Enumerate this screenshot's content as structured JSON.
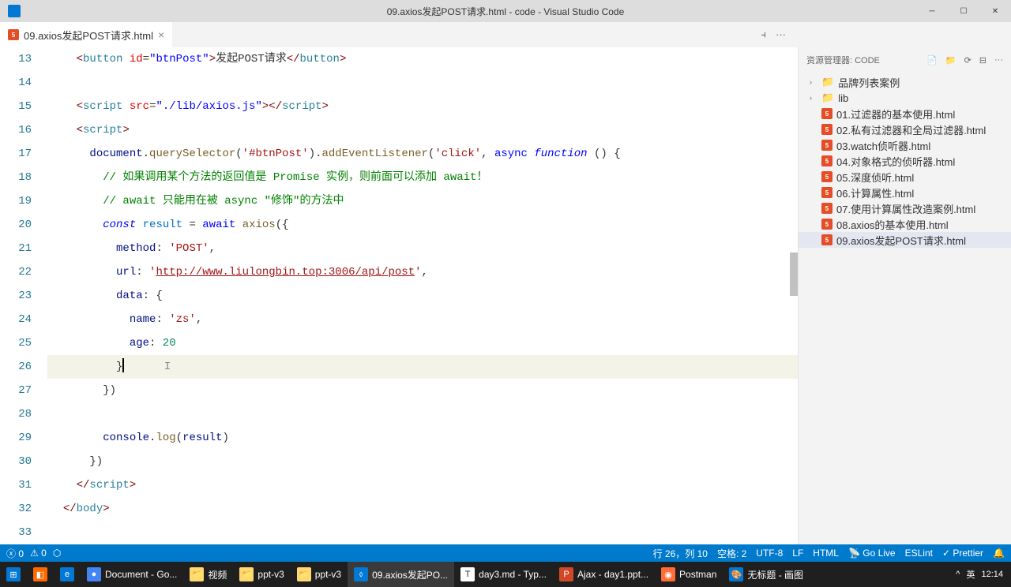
{
  "window": {
    "title": "09.axios发起POST请求.html - code - Visual Studio Code"
  },
  "tab": {
    "filename": "09.axios发起POST请求.html"
  },
  "lineNumbers": [
    "13",
    "14",
    "15",
    "16",
    "17",
    "18",
    "19",
    "20",
    "21",
    "22",
    "23",
    "24",
    "25",
    "26",
    "27",
    "28",
    "29",
    "30",
    "31",
    "32",
    "33"
  ],
  "code": {
    "l13_button": "button",
    "l13_id": "id",
    "l13_idval": "\"btnPost\"",
    "l13_text": "发起POST请求",
    "l15_script": "script",
    "l15_src": "src",
    "l15_srcval": "\"./lib/axios.js\"",
    "l17_doc": "document",
    "l17_qs": "querySelector",
    "l17_sel": "'#btnPost'",
    "l17_ael": "addEventListener",
    "l17_click": "'click'",
    "l17_async": "async",
    "l17_func": "function",
    "l18_comment": "// 如果调用某个方法的返回值是 Promise 实例，则前面可以添加 await！",
    "l19_comment": "// await 只能用在被 async \"修饰\"的方法中",
    "l20_const": "const",
    "l20_result": "result",
    "l20_await": "await",
    "l20_axios": "axios",
    "l21_method": "method",
    "l21_post": "'POST'",
    "l22_url": "url",
    "l22_urlval": "http://www.liulongbin.top:3006/api/post",
    "l23_data": "data",
    "l24_name": "name",
    "l24_zs": "'zs'",
    "l25_age": "age",
    "l25_val": "20",
    "l29_console": "console",
    "l29_log": "log",
    "l29_result": "result",
    "l31_script": "script",
    "l32_body": "body"
  },
  "explorer": {
    "header": "资源管理器: CODE",
    "items": [
      {
        "type": "folder",
        "label": "品牌列表案例"
      },
      {
        "type": "folder",
        "label": "lib"
      },
      {
        "type": "file",
        "label": "01.过滤器的基本使用.html"
      },
      {
        "type": "file",
        "label": "02.私有过滤器和全局过滤器.html"
      },
      {
        "type": "file",
        "label": "03.watch侦听器.html"
      },
      {
        "type": "file",
        "label": "04.对象格式的侦听器.html"
      },
      {
        "type": "file",
        "label": "05.深度侦听.html"
      },
      {
        "type": "file",
        "label": "06.计算属性.html"
      },
      {
        "type": "file",
        "label": "07.使用计算属性改造案例.html"
      },
      {
        "type": "file",
        "label": "08.axios的基本使用.html"
      },
      {
        "type": "file",
        "label": "09.axios发起POST请求.html",
        "active": true
      }
    ]
  },
  "statusbar": {
    "errors": "0",
    "warnings": "0",
    "line_col": "行 26，列 10",
    "spaces": "空格: 2",
    "encoding": "UTF-8",
    "eol": "LF",
    "lang": "HTML",
    "golive": "Go Live",
    "eslint": "ESLint",
    "prettier": "Prettier"
  },
  "taskbar": {
    "items": [
      {
        "label": "Document - Go...",
        "color": "#4285f4"
      },
      {
        "label": "视频",
        "color": "#ffd86f"
      },
      {
        "label": "ppt-v3",
        "color": "#ffd86f"
      },
      {
        "label": "ppt-v3",
        "color": "#ffd86f"
      },
      {
        "label": "09.axios发起PO...",
        "color": "#0078d4",
        "active": true
      },
      {
        "label": "day3.md - Typ...",
        "color": "#ffffff"
      },
      {
        "label": "Ajax - day1.ppt...",
        "color": "#d24726"
      },
      {
        "label": "Postman",
        "color": "#ff6c37"
      },
      {
        "label": "无标题 - 画图",
        "color": "#0078d4"
      }
    ],
    "tray_time": "12:14",
    "tray_lang": "英"
  }
}
